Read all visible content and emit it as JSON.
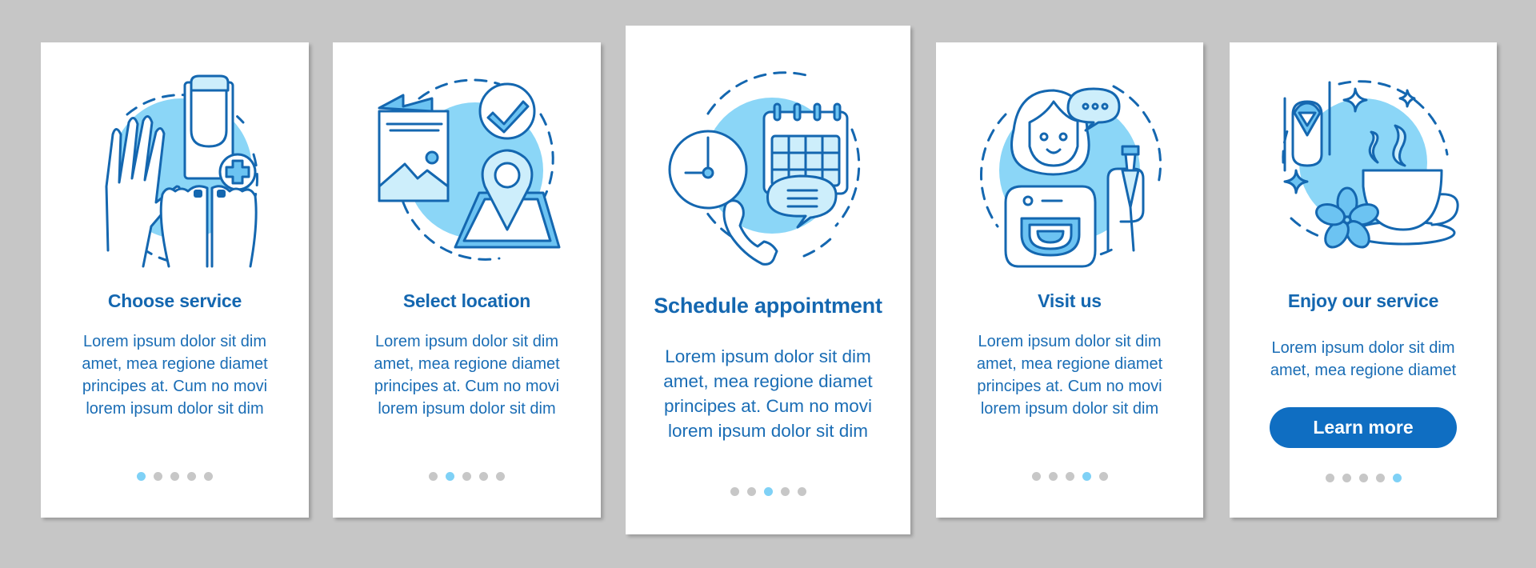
{
  "colors": {
    "background": "#c6c6c6",
    "card": "#ffffff",
    "primary": "#1467b0",
    "text": "#1a6db5",
    "button": "#0f6ec2",
    "accent_light": "#8bd6f7",
    "dot_active": "#7fd1f6",
    "dot_inactive": "#c7c7c7"
  },
  "cards": [
    {
      "icon": "manicure-pedicure-icon",
      "title": "Choose service",
      "body": "Lorem ipsum dolor sit dim\namet, mea regione diamet\nprincipes at. Cum no movi\nlorem ipsum dolor sit dim",
      "active_step": 1
    },
    {
      "icon": "location-map-icon",
      "title": "Select location",
      "body": "Lorem ipsum dolor sit dim\namet, mea regione diamet\nprincipes at. Cum no movi\nlorem ipsum dolor sit dim",
      "active_step": 2
    },
    {
      "icon": "schedule-calendar-icon",
      "title": "Schedule appointment",
      "body": "Lorem ipsum dolor sit dim\namet, mea regione diamet\nprincipes at. Cum no movi\nlorem ipsum dolor sit dim",
      "active_step": 3
    },
    {
      "icon": "salon-visit-icon",
      "title": "Visit us",
      "body": "Lorem ipsum dolor sit dim\namet, mea regione diamet\nprincipes at. Cum no movi\nlorem ipsum dolor sit dim",
      "active_step": 4
    },
    {
      "icon": "relax-tea-icon",
      "title": "Enjoy our service",
      "body": "Lorem ipsum dolor sit dim\namet, mea regione diamet",
      "button_label": "Learn more",
      "active_step": 5
    }
  ],
  "total_steps": 5
}
